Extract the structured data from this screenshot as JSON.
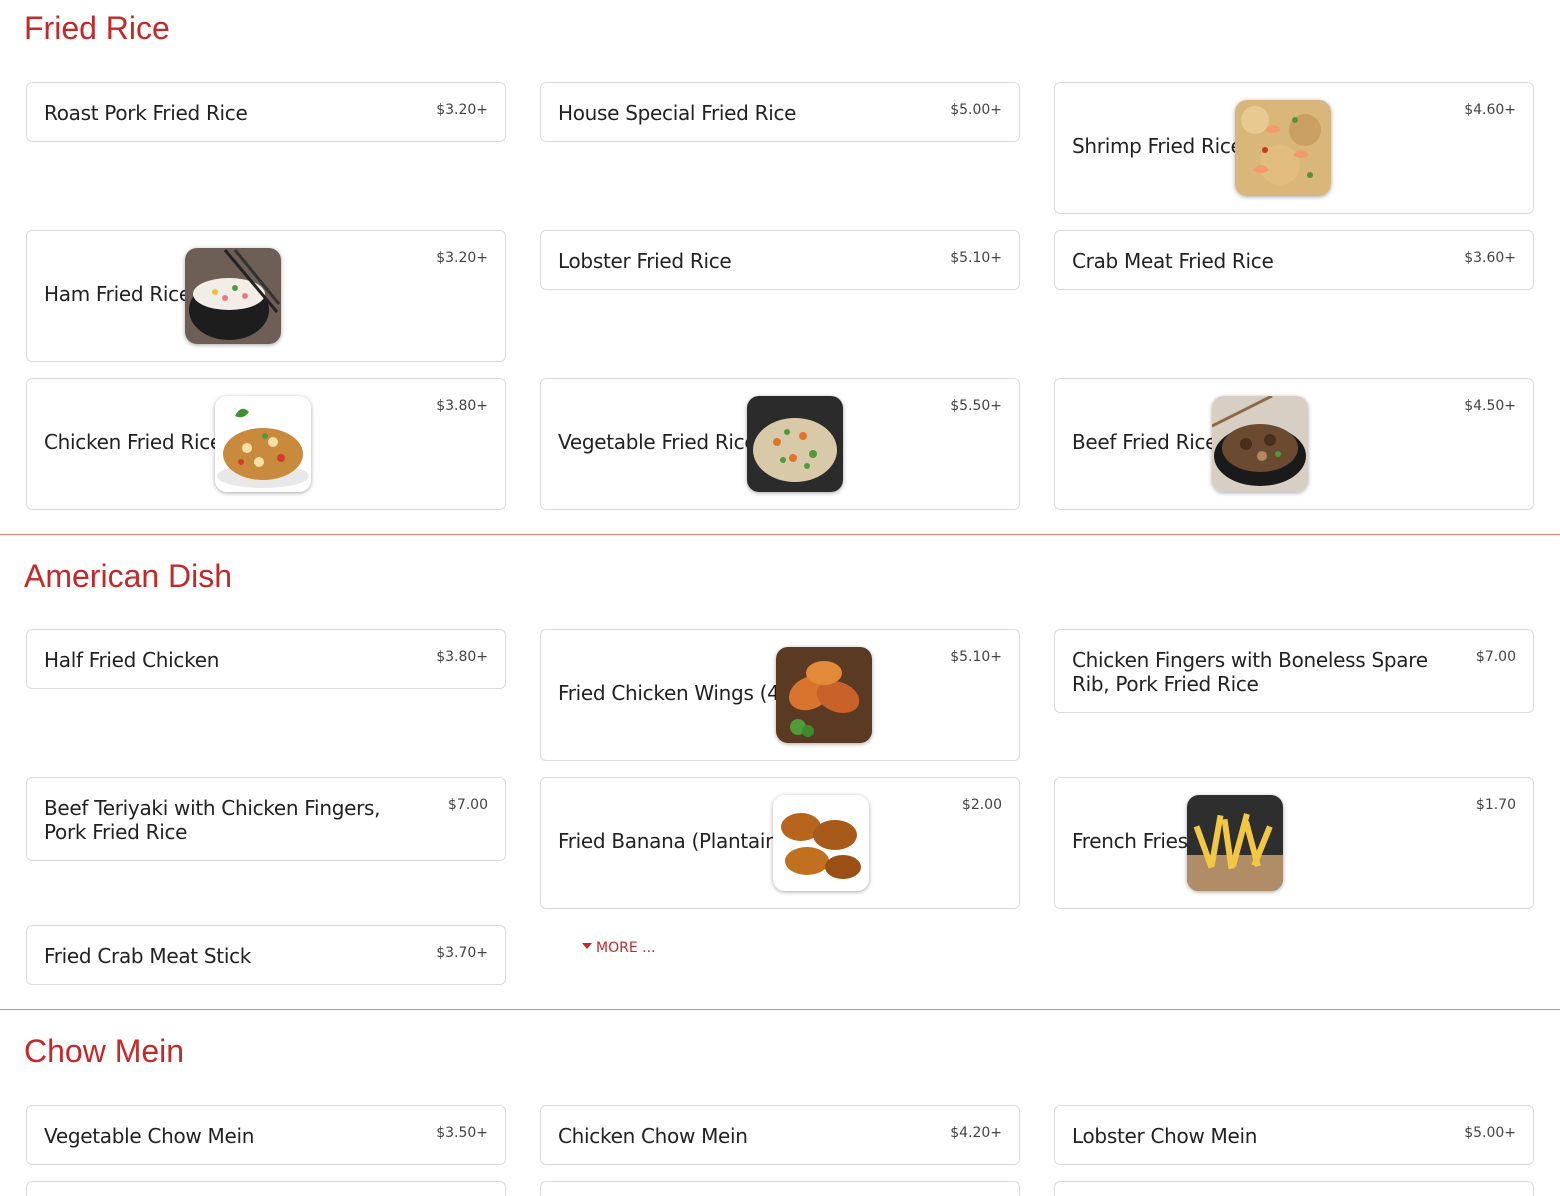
{
  "sections": {
    "fried_rice": {
      "title": "Fried Rice",
      "items": [
        {
          "name": "Roast Pork Fried Rice",
          "price": "$3.20+"
        },
        {
          "name": "House Special Fried Rice",
          "price": "$5.00+"
        },
        {
          "name": "Shrimp Fried Rice",
          "price": "$4.60+",
          "image": "shrimp-fried-rice-photo"
        },
        {
          "name": "Ham Fried Rice",
          "price": "$3.20+",
          "image": "ham-fried-rice-photo"
        },
        {
          "name": "Lobster Fried Rice",
          "price": "$5.10+"
        },
        {
          "name": "Crab Meat Fried Rice",
          "price": "$3.60+"
        },
        {
          "name": "Chicken Fried Rice",
          "price": "$3.80+",
          "image": "chicken-fried-rice-photo"
        },
        {
          "name": "Vegetable Fried Rice",
          "price": "$5.50+",
          "image": "vegetable-fried-rice-photo"
        },
        {
          "name": "Beef Fried Rice",
          "price": "$4.50+",
          "image": "beef-fried-rice-photo"
        }
      ]
    },
    "american_dish": {
      "title": "American Dish",
      "items": [
        {
          "name": "Half Fried Chicken",
          "price": "$3.80+"
        },
        {
          "name": "Fried Chicken Wings (4)",
          "price": "$5.10+",
          "image": "fried-chicken-wings-photo"
        },
        {
          "name": "Chicken Fingers with Boneless Spare Rib, Pork Fried Rice",
          "price": "$7.00"
        },
        {
          "name": "Beef Teriyaki with Chicken Fingers, Pork Fried Rice",
          "price": "$7.00"
        },
        {
          "name": "Fried Banana (Plantain)",
          "price": "$2.00",
          "image": "fried-plantain-photo"
        },
        {
          "name": "French Fries",
          "price": "$1.70",
          "image": "french-fries-photo"
        },
        {
          "name": "Fried Crab Meat Stick",
          "price": "$3.70+"
        }
      ],
      "more_label": "MORE ..."
    },
    "chow_mein": {
      "title": "Chow Mein",
      "items": [
        {
          "name": "Vegetable Chow Mein",
          "price": "$3.50+"
        },
        {
          "name": "Chicken Chow Mein",
          "price": "$4.20+"
        },
        {
          "name": "Lobster Chow Mein",
          "price": "$5.00+"
        }
      ]
    }
  },
  "colors": {
    "accent": "#c62828",
    "card_border": "#dcdcdc",
    "text": "#222222"
  }
}
